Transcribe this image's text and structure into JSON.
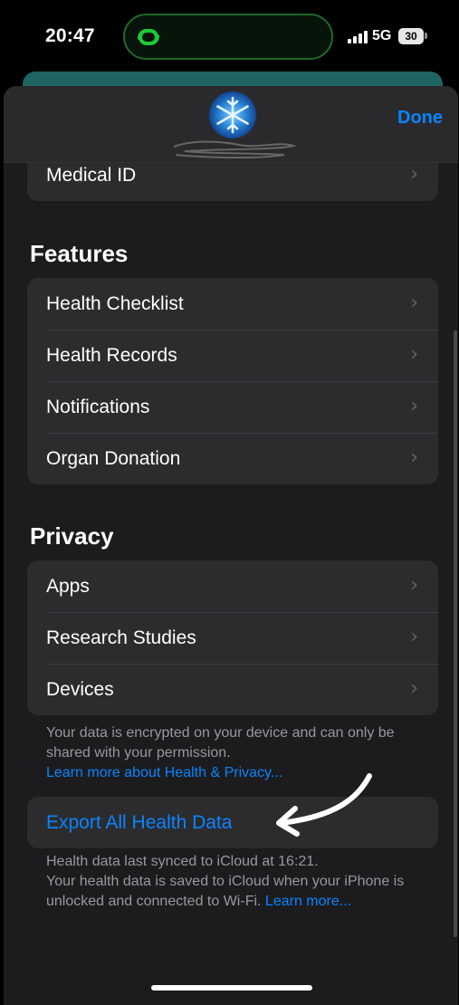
{
  "status_bar": {
    "time": "20:47",
    "network": "5G",
    "battery": "30"
  },
  "header": {
    "done_label": "Done"
  },
  "medical_id": {
    "label": "Medical ID"
  },
  "features": {
    "title": "Features",
    "items": [
      {
        "label": "Health Checklist"
      },
      {
        "label": "Health Records"
      },
      {
        "label": "Notifications"
      },
      {
        "label": "Organ Donation"
      }
    ]
  },
  "privacy": {
    "title": "Privacy",
    "items": [
      {
        "label": "Apps"
      },
      {
        "label": "Research Studies"
      },
      {
        "label": "Devices"
      }
    ],
    "footnote": "Your data is encrypted on your device and can only be shared with your permission.",
    "footnote_link": "Learn more about Health & Privacy..."
  },
  "export": {
    "label": "Export All Health Data",
    "footnote_line1": "Health data last synced to iCloud at 16:21.",
    "footnote_line2": "Your health data is saved to iCloud when your iPhone is unlocked and connected to Wi-Fi.",
    "footnote_link": "Learn more..."
  },
  "colors": {
    "accent": "#0a84ff",
    "background": "#000000",
    "sheet": "#1c1c1e",
    "cell": "#2c2c2e",
    "island_accent": "#1ec93a"
  },
  "icons": {
    "chevron": "chevron-right-icon",
    "island": "link-rings-icon",
    "signal": "signal-bars-icon",
    "avatar": "snowflake-avatar"
  }
}
